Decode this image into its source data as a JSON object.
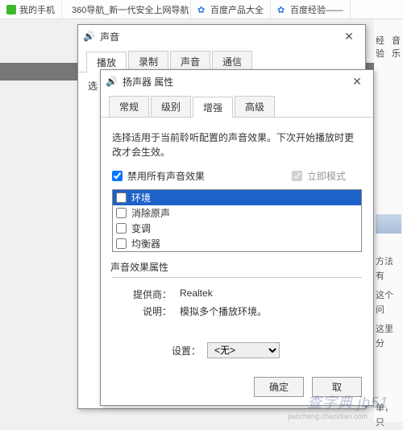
{
  "browser": {
    "tabs": [
      {
        "label": "我的手机"
      },
      {
        "label": "360导航_新一代安全上网导航"
      },
      {
        "label": "百度产品大全"
      },
      {
        "label": "百度经验——"
      }
    ]
  },
  "right": {
    "link1": "经验",
    "link2": "音乐",
    "snip1": "方法有",
    "snip2": "这个问",
    "snip3": "这里分",
    "snip4": "单，只"
  },
  "sound_dialog": {
    "title": "声音",
    "tabs": [
      "播放",
      "录制",
      "声音",
      "通信"
    ],
    "active_tab": "播放",
    "hint": "选"
  },
  "speaker_dialog": {
    "title": "扬声器 属性",
    "tabs": [
      "常规",
      "级别",
      "增强",
      "高级"
    ],
    "active_tab": "增强",
    "description": "选择适用于当前聆听配置的声音效果。下次开始播放时更改才会生效。",
    "chk_disable_all": {
      "label": "禁用所有声音效果",
      "checked": true
    },
    "chk_immediate": {
      "label": "立即模式",
      "checked": true
    },
    "enhancements": [
      {
        "label": "环境",
        "checked": false,
        "selected": true
      },
      {
        "label": "消除原声",
        "checked": false,
        "selected": false
      },
      {
        "label": "变调",
        "checked": false,
        "selected": false
      },
      {
        "label": "均衡器",
        "checked": false,
        "selected": false
      }
    ],
    "group_title": "声音效果属性",
    "provider_label": "提供商：",
    "provider_value": "Realtek",
    "desc_label": "说明：",
    "desc_value": "模拟多个播放环境。",
    "settings_label": "设置：",
    "settings_value": "<无>",
    "ok": "确定",
    "cancel": "取"
  },
  "watermark": {
    "main": "查字典 jb51",
    "sub": "jiaocheng.chazidian.com"
  }
}
